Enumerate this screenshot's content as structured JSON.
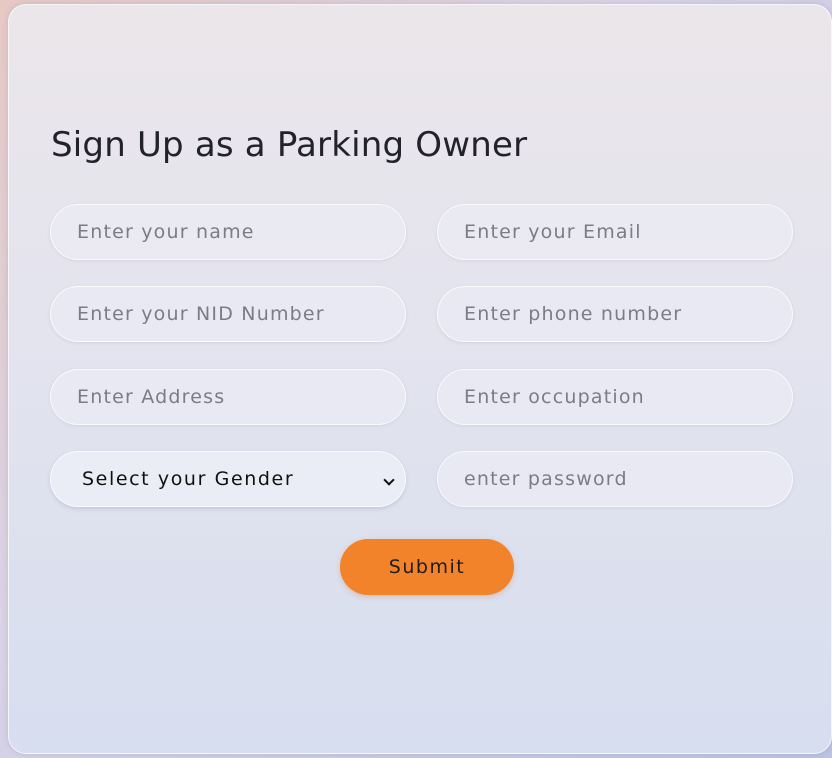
{
  "form": {
    "title": "Sign Up as a Parking Owner",
    "fields": {
      "name": {
        "placeholder": "Enter your name",
        "value": ""
      },
      "email": {
        "placeholder": "Enter your Email",
        "value": ""
      },
      "nid": {
        "placeholder": "Enter your NID Number",
        "value": ""
      },
      "phone": {
        "placeholder": "Enter phone number",
        "value": ""
      },
      "address": {
        "placeholder": "Enter Address",
        "value": ""
      },
      "occupation": {
        "placeholder": "Enter occupation",
        "value": ""
      },
      "gender": {
        "selected": "Select your Gender"
      },
      "password": {
        "placeholder": "enter password",
        "value": ""
      }
    },
    "submit_label": "Submit"
  },
  "colors": {
    "accent": "#f2832a",
    "text": "#22222a"
  }
}
